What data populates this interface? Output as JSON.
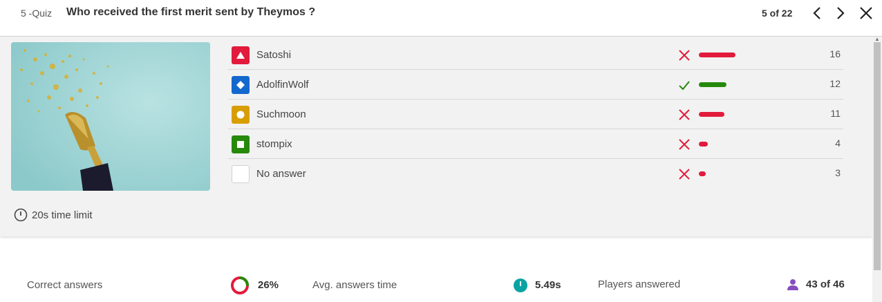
{
  "header": {
    "question_number": "5 -Quiz",
    "question_title": "Who received the first merit sent by Theymos ?",
    "pager": "5 of 22"
  },
  "answers": [
    {
      "label": "Satoshi",
      "shape_icon": "triangle-icon",
      "shape_color": "#e21b3c",
      "correct": false,
      "count": "16",
      "fraction": 0.372
    },
    {
      "label": "AdolfinWolf",
      "shape_icon": "diamond-icon",
      "shape_color": "#1368ce",
      "correct": true,
      "count": "12",
      "fraction": 0.279
    },
    {
      "label": "Suchmoon",
      "shape_icon": "circle-icon",
      "shape_color": "#d89e00",
      "correct": false,
      "count": "11",
      "fraction": 0.256
    },
    {
      "label": "stompix",
      "shape_icon": "square-icon",
      "shape_color": "#26890c",
      "correct": false,
      "count": "4",
      "fraction": 0.093
    },
    {
      "label": "No answer",
      "shape_icon": "empty-icon",
      "shape_color": "#ffffff",
      "correct": false,
      "count": "3",
      "fraction": 0.07
    }
  ],
  "time_limit": "20s time limit",
  "stats": {
    "correct_label": "Correct answers",
    "correct_value": "26%",
    "correct_fraction": 0.26,
    "avg_time_label": "Avg. answers time",
    "avg_time_value": "5.49s",
    "players_label": "Players answered",
    "players_value": "43 of 46"
  },
  "colors": {
    "incorrect": "#e21b3c",
    "correct": "#26890c",
    "accent_teal": "#0aa3a3",
    "accent_purple": "#864cbf"
  }
}
